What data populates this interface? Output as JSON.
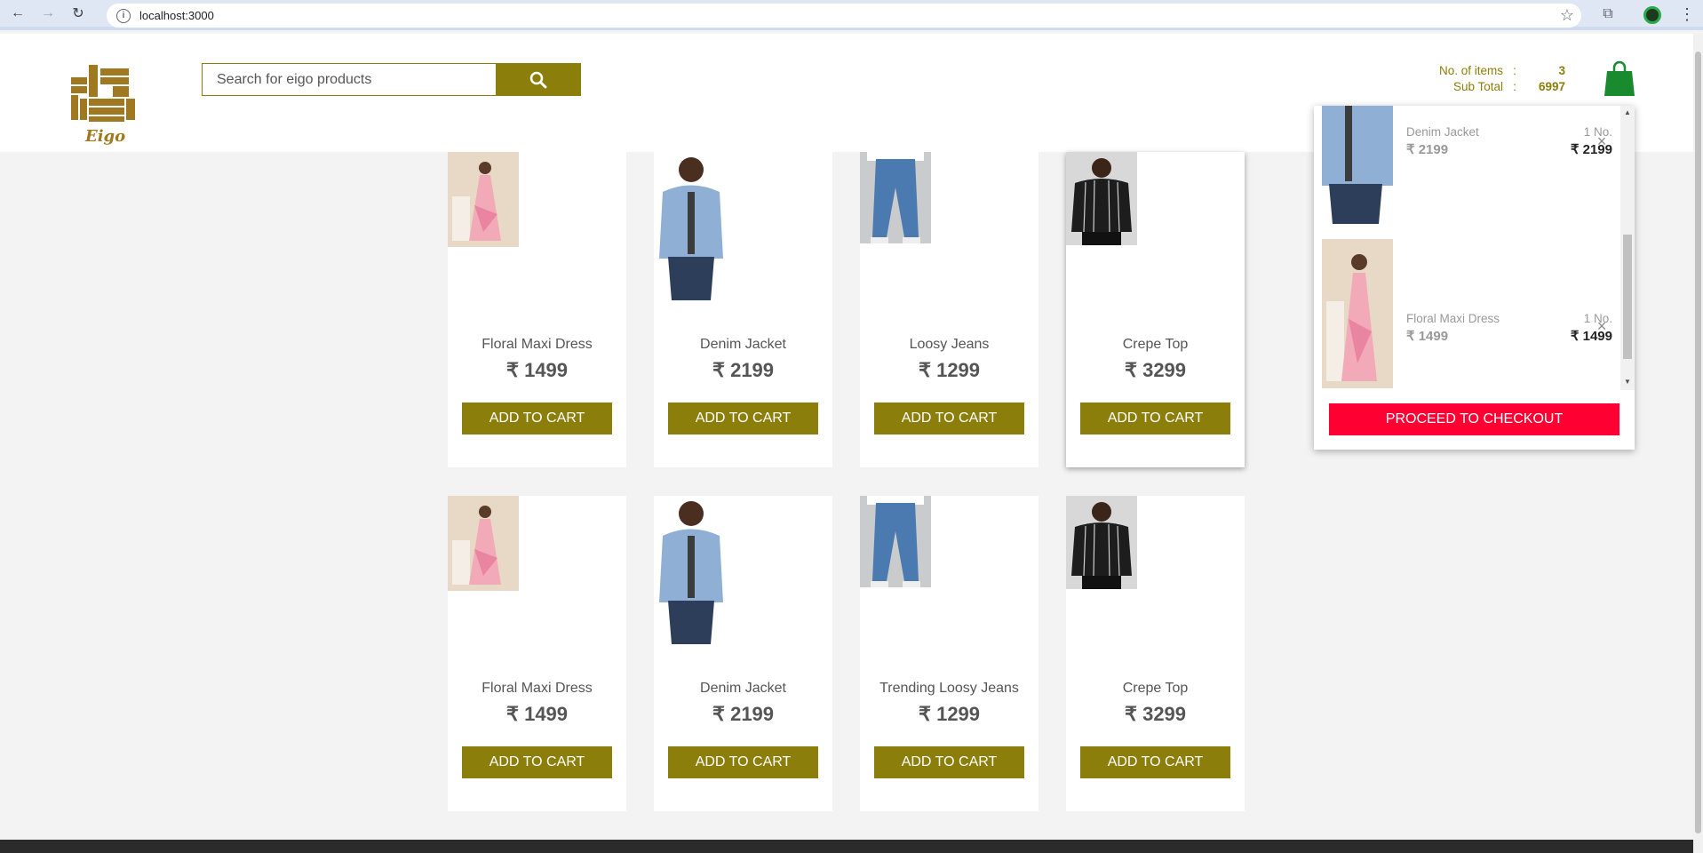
{
  "browser": {
    "url": "localhost:3000"
  },
  "header": {
    "logo_text": "Eigo",
    "search_placeholder": "Search for eigo products",
    "cart_summary": {
      "items_label": "No. of items",
      "items_value": "3",
      "subtotal_label": "Sub Total",
      "subtotal_value": "6997",
      "separator": ":"
    }
  },
  "products": [
    {
      "name": "Floral Maxi Dress",
      "price": "₹ 1499",
      "button": "ADD TO CART"
    },
    {
      "name": "Denim Jacket",
      "price": "₹ 2199",
      "button": "ADD TO CART"
    },
    {
      "name": "Loosy Jeans",
      "price": "₹ 1299",
      "button": "ADD TO CART"
    },
    {
      "name": "Crepe Top",
      "price": "₹ 3299",
      "button": "ADD TO CART"
    },
    {
      "name": "Floral Maxi Dress",
      "price": "₹ 1499",
      "button": "ADD TO CART"
    },
    {
      "name": "Denim Jacket",
      "price": "₹ 2199",
      "button": "ADD TO CART"
    },
    {
      "name": "Trending Loosy Jeans",
      "price": "₹ 1299",
      "button": "ADD TO CART"
    },
    {
      "name": "Crepe Top",
      "price": "₹ 3299",
      "button": "ADD TO CART"
    }
  ],
  "cart_dropdown": {
    "items": [
      {
        "name": "Denim Jacket",
        "price": "₹ 2199",
        "qty": "1 No.",
        "total": "₹ 2199"
      },
      {
        "name": "Floral Maxi Dress",
        "price": "₹ 1499",
        "qty": "1 No.",
        "total": "₹ 1499"
      }
    ],
    "checkout_label": "PROCEED TO CHECKOUT",
    "remove_glyph": "×"
  },
  "colors": {
    "brand": "#8b7e0b",
    "checkout": "#ff0032",
    "bag": "#1a8a2e"
  }
}
